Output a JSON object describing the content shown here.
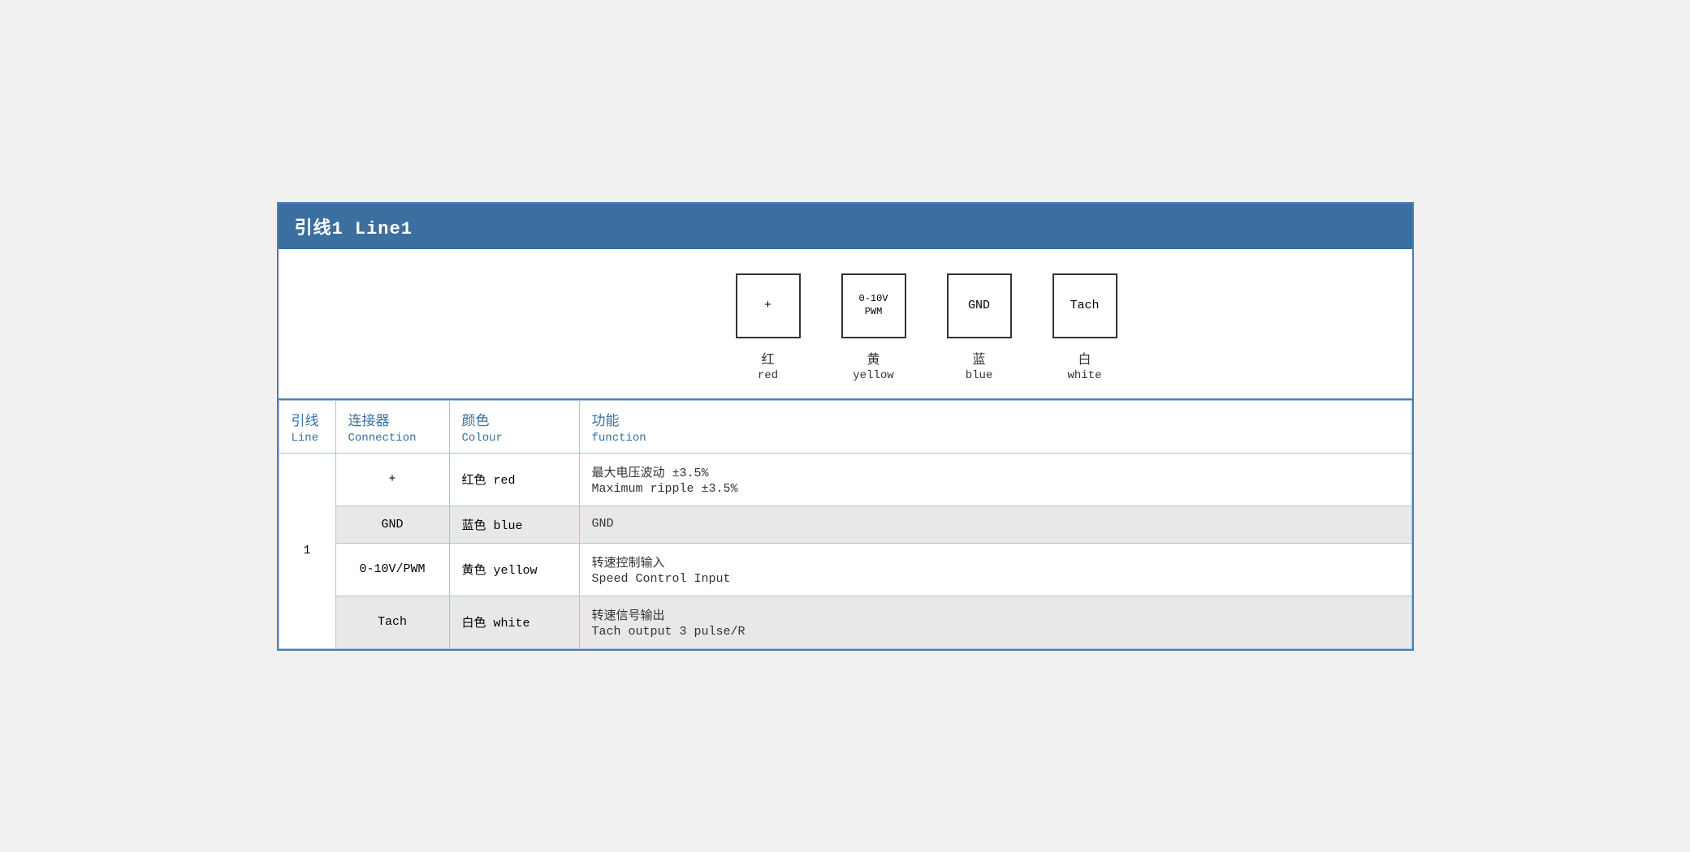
{
  "header": {
    "title": "引线1 Line1"
  },
  "diagram": {
    "connectors": [
      {
        "symbol": "+",
        "label_zh": "红",
        "label_en": "red"
      },
      {
        "symbol": "0-10V\nPWM",
        "label_zh": "黄",
        "label_en": "yellow"
      },
      {
        "symbol": "GND",
        "label_zh": "蓝",
        "label_en": "blue"
      },
      {
        "symbol": "Tach",
        "label_zh": "白",
        "label_en": "white"
      }
    ]
  },
  "table": {
    "columns": [
      {
        "zh": "引线",
        "en": "Line"
      },
      {
        "zh": "连接器",
        "en": "Connection"
      },
      {
        "zh": "颜色",
        "en": "Colour"
      },
      {
        "zh": "功能",
        "en": "function"
      }
    ],
    "rows": [
      {
        "line": "1",
        "connection": "+",
        "colour_zh": "红色 red",
        "function_zh": "最大电压波动 ±3.5%",
        "function_en": "Maximum ripple ±3.5%",
        "shaded": false,
        "rowspan": 4
      },
      {
        "line": "",
        "connection": "GND",
        "colour_zh": "蓝色 blue",
        "function_zh": "GND",
        "function_en": "",
        "shaded": true
      },
      {
        "line": "",
        "connection": "0-10V/PWM",
        "colour_zh": "黄色 yellow",
        "function_zh": "转速控制输入",
        "function_en": "Speed Control Input",
        "shaded": false
      },
      {
        "line": "",
        "connection": "Tach",
        "colour_zh": "白色 white",
        "function_zh": "转速信号输出",
        "function_en": "Tach output 3 pulse/R",
        "shaded": true
      }
    ]
  }
}
